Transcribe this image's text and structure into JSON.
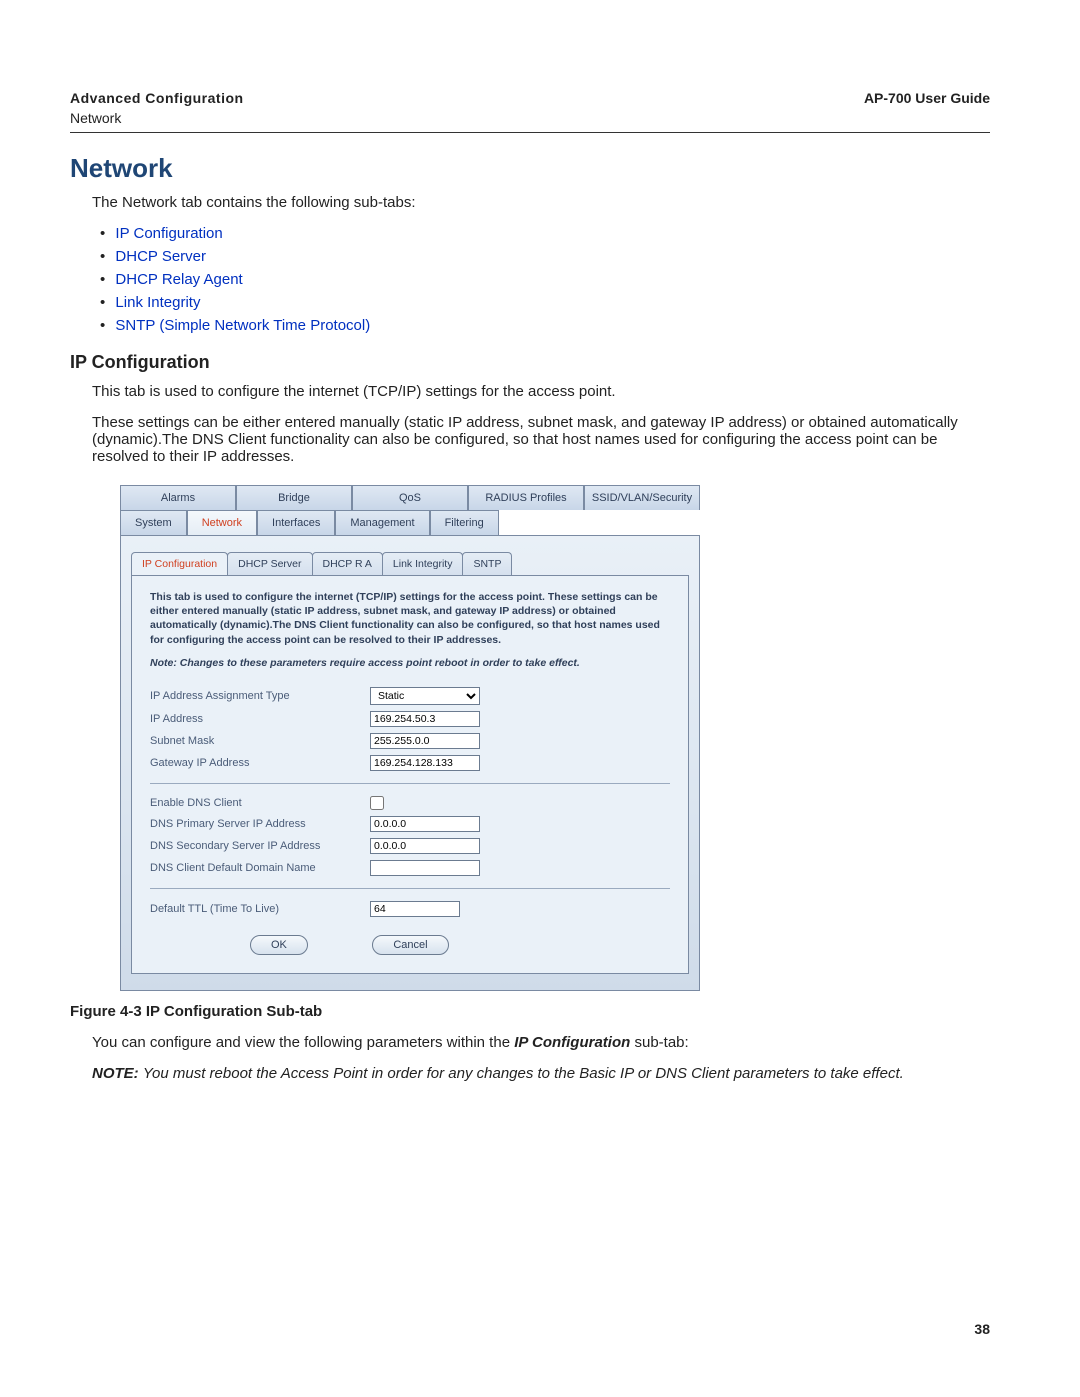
{
  "header": {
    "section": "Advanced Configuration",
    "breadcrumb": "Network",
    "guide": "AP-700 User Guide"
  },
  "h1": "Network",
  "intro": "The Network tab contains the following sub-tabs:",
  "links": [
    "IP Configuration",
    "DHCP Server",
    "DHCP Relay Agent",
    "Link Integrity",
    "SNTP (Simple Network Time Protocol)"
  ],
  "h2": "IP Configuration",
  "p1": "This tab is used to configure the internet (TCP/IP) settings for the access point.",
  "p2": "These settings can be either entered manually (static IP address, subnet mask, and gateway IP address) or obtained automatically (dynamic).The DNS Client functionality can also be configured, so that host names used for configuring the access point can be resolved to their IP addresses.",
  "figure_caption": "Figure 4-3 IP Configuration Sub-tab",
  "after_fig_pre": "You can configure and view the following parameters within the ",
  "after_fig_strong": "IP Configuration",
  "after_fig_post": " sub-tab:",
  "note_label": "NOTE:  ",
  "note_text": "You must reboot the Access Point in order for any changes to the Basic IP or DNS Client parameters to take effect.",
  "pagenum": "38",
  "shot": {
    "tabs_top": [
      "Alarms",
      "Bridge",
      "QoS",
      "RADIUS Profiles",
      "SSID/VLAN/Security"
    ],
    "tabs_main": [
      "System",
      "Network",
      "Interfaces",
      "Management",
      "Filtering"
    ],
    "active_main": "Network",
    "subtabs": [
      "IP Configuration",
      "DHCP Server",
      "DHCP R A",
      "Link Integrity",
      "SNTP"
    ],
    "active_subtab": "IP Configuration",
    "blurb": "This tab is used to configure the internet (TCP/IP) settings for the access point. These settings can be either entered manually (static IP address, subnet mask, and gateway IP address) or obtained automatically (dynamic).The DNS Client functionality can also be configured, so that host names used for configuring the access point can be resolved to their IP addresses.",
    "notei": "Note: Changes to these parameters require access point reboot in order to take effect.",
    "fields": {
      "ip_assign_label": "IP Address Assignment Type",
      "ip_assign_value": "Static",
      "ip_addr_label": "IP Address",
      "ip_addr_value": "169.254.50.3",
      "subnet_label": "Subnet Mask",
      "subnet_value": "255.255.0.0",
      "gateway_label": "Gateway IP Address",
      "gateway_value": "169.254.128.133",
      "dns_enable_label": "Enable DNS Client",
      "dns_primary_label": "DNS Primary Server IP Address",
      "dns_primary_value": "0.0.0.0",
      "dns_secondary_label": "DNS Secondary Server IP Address",
      "dns_secondary_value": "0.0.0.0",
      "dns_domain_label": "DNS Client Default Domain Name",
      "dns_domain_value": "",
      "ttl_label": "Default TTL (Time To Live)",
      "ttl_value": "64"
    },
    "buttons": {
      "ok": "OK",
      "cancel": "Cancel"
    }
  }
}
